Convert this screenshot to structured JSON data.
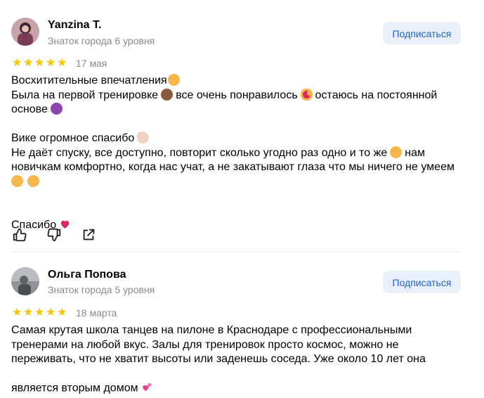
{
  "reviews": [
    {
      "author": "Yanzina T.",
      "level": "Знаток города 6 уровня",
      "subscribe_label": "Подписаться",
      "rating": 5,
      "date": "17 мая",
      "line1": "Восхитительные впечатления",
      "line2a": "Была на первой тренировке",
      "line2b": "все очень понравилось",
      "line2c": "остаюсь на постоянной",
      "line3": "основе",
      "line4": "Вике огромное спасибо",
      "line5a": "Не даёт спуску, все доступно, повторит сколько угодно раз одно и то же",
      "line5b": "нам",
      "line6": "новичкам комфортно, когда нас учат, а не закатывают глаза что мы ничего не умеем",
      "line8": "Спасибо",
      "actions": [
        "like-icon",
        "dislike-icon",
        "share-icon"
      ]
    },
    {
      "author": "Ольга Попова",
      "level": "Знаток города 5 уровня",
      "subscribe_label": "Подписаться",
      "rating": 5,
      "date": "18 марта",
      "text": "Самая крутая школа танцев на пилоне в Краснодаре с профессиональными\nтренерами на любой вкус. Залы для тренировок просто космос, можно не\nпереживать, что не хватит высоты или заденешь соседа. Уже около 10 лет она\nявляется вторым домом"
    }
  ],
  "colors": {
    "star": "#f9c400",
    "subscribe_bg": "#e8f0fb",
    "subscribe_text": "#2362c8",
    "muted": "#8a8a8a"
  }
}
